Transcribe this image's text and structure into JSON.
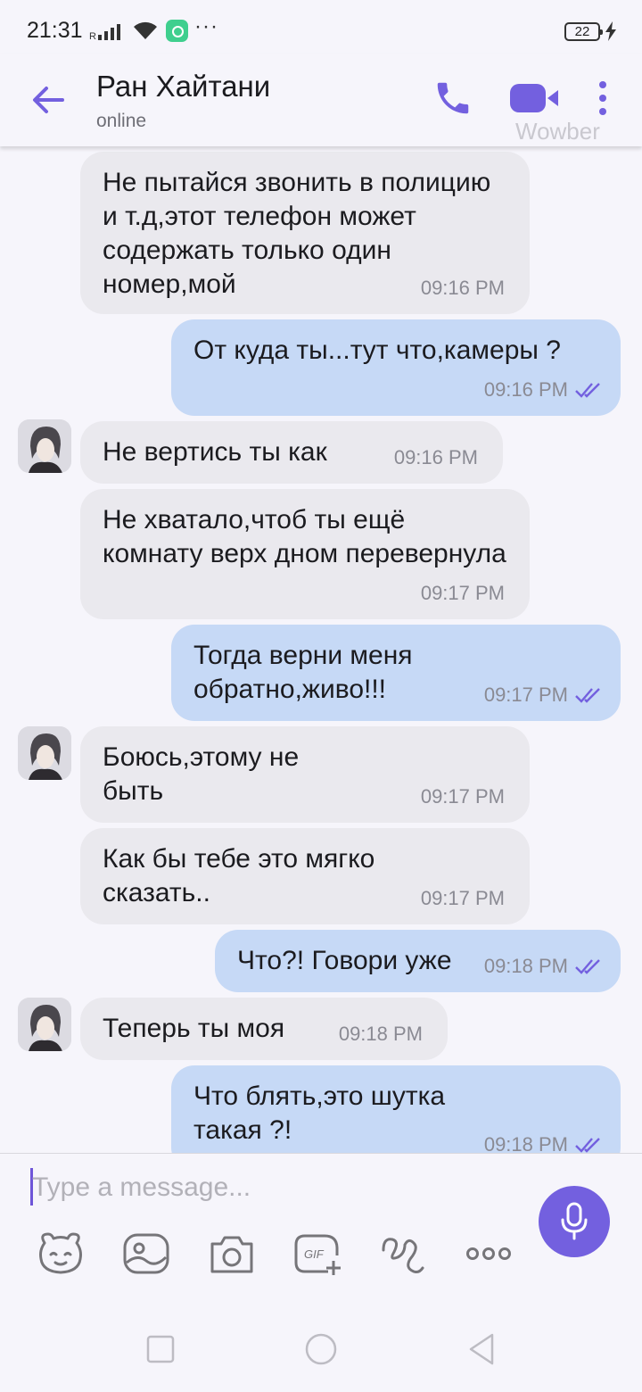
{
  "status_bar": {
    "time": "21:31",
    "signal_label": "R",
    "more": "···",
    "battery": "22"
  },
  "header": {
    "contact_name": "Ран Хайтани",
    "status": "online",
    "watermark": "Wowber",
    "accent_color": "#7360df"
  },
  "messages": [
    {
      "direction": "in",
      "text": "Не пытайся звонить в полицию и т.д,этот телефон может содержать только один номер,мой",
      "time": "09:16 PM"
    },
    {
      "direction": "out",
      "text": "От куда ты...тут что,камеры ?",
      "time": "09:16 PM",
      "status": "read"
    },
    {
      "direction": "in",
      "text": "Не вертись ты как",
      "time": "09:16 PM",
      "avatar": true
    },
    {
      "direction": "in",
      "text": "Не хватало,чтоб ты ещё комнату верх дном перевернула",
      "time": "09:17 PM"
    },
    {
      "direction": "out",
      "text": "Тогда верни меня обратно,живо!!!",
      "time": "09:17 PM",
      "status": "read"
    },
    {
      "direction": "in",
      "text": "Боюсь,этому не быть",
      "time": "09:17 PM",
      "avatar": true
    },
    {
      "direction": "in",
      "text": "Как бы тебе это мягко сказать..",
      "time": "09:17 PM"
    },
    {
      "direction": "out",
      "text": "Что?! Говори уже",
      "time": "09:18 PM",
      "status": "read"
    },
    {
      "direction": "in",
      "text": "Теперь ты моя",
      "time": "09:18 PM",
      "avatar": true
    },
    {
      "direction": "out",
      "text": "Что блять,это шутка такая ?!",
      "time": "09:18 PM",
      "status": "read"
    }
  ],
  "composer": {
    "placeholder": "Type a message..."
  },
  "toolbar": {
    "icons": [
      "sticker-icon",
      "gallery-icon",
      "camera-icon",
      "gif-icon",
      "doodle-icon",
      "more-icon"
    ],
    "gif_label": "GIF"
  }
}
